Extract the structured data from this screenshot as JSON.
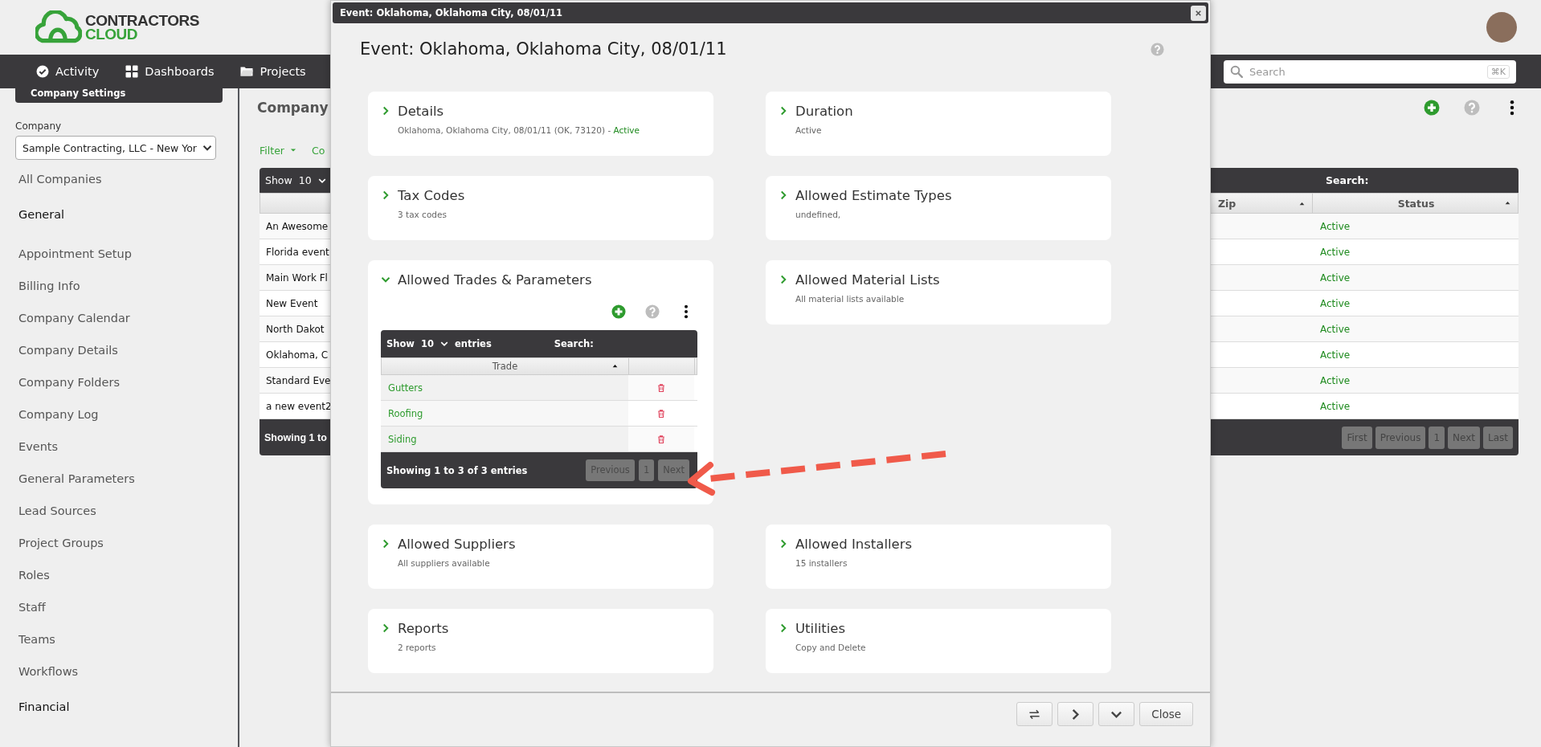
{
  "logo": {
    "line_1": "CONTRACTORS",
    "line_2": "CLOUD"
  },
  "nav": [
    {
      "label": "Activity"
    },
    {
      "label": "Dashboards"
    },
    {
      "label": "Projects"
    }
  ],
  "global_search": {
    "placeholder": "Search",
    "shortcut": "⌘K"
  },
  "sidebar": {
    "section_tab": "Company Settings",
    "company_label": "Company",
    "company_select": "Sample Contracting, LLC - New Yor",
    "items": [
      {
        "label": "All Companies",
        "kind": "link"
      },
      {
        "label": "General",
        "kind": "heading"
      },
      {
        "label": "Appointment Setup",
        "kind": "link"
      },
      {
        "label": "Billing Info",
        "kind": "link"
      },
      {
        "label": "Company Calendar",
        "kind": "link"
      },
      {
        "label": "Company Details",
        "kind": "link"
      },
      {
        "label": "Company Folders",
        "kind": "link"
      },
      {
        "label": "Company Log",
        "kind": "link"
      },
      {
        "label": "Events",
        "kind": "link"
      },
      {
        "label": "General Parameters",
        "kind": "link"
      },
      {
        "label": "Lead Sources",
        "kind": "link"
      },
      {
        "label": "Project Groups",
        "kind": "link"
      },
      {
        "label": "Roles",
        "kind": "link"
      },
      {
        "label": "Staff",
        "kind": "link"
      },
      {
        "label": "Teams",
        "kind": "link"
      },
      {
        "label": "Workflows",
        "kind": "link"
      },
      {
        "label": "Financial",
        "kind": "heading"
      }
    ]
  },
  "background": {
    "heading": "Company",
    "toolbar": [
      {
        "label": "Filter",
        "dropdown": true
      },
      {
        "label": "Co",
        "dropdown": false
      }
    ],
    "table": {
      "show": "Show",
      "show_value": "10",
      "search_label": "Search:",
      "columns": [
        "Zip",
        "Status"
      ],
      "rows": [
        {
          "column_1": "An Awesome",
          "status": "Active"
        },
        {
          "column_1": "Florida event",
          "status": "Active"
        },
        {
          "column_1": "Main Work Fl",
          "status": "Active"
        },
        {
          "column_1": "New Event",
          "status": "Active"
        },
        {
          "column_1": "North Dakot",
          "status": "Active"
        },
        {
          "column_1": "Oklahoma, C",
          "status": "Active"
        },
        {
          "column_1": "Standard Eve",
          "status": "Active"
        },
        {
          "column_1": "a new event2",
          "status": "Active"
        }
      ],
      "footer": "Showing 1 to",
      "pages": [
        "First",
        "Previous",
        "1",
        "Next",
        "Last"
      ]
    }
  },
  "modal": {
    "title_bar": "Event: Oklahoma, Oklahoma City, 08/01/11",
    "heading": "Event: Oklahoma, Oklahoma City, 08/01/11",
    "cards": [
      {
        "title": "Details",
        "subtitle": "Oklahoma, Oklahoma City, 08/01/11 (OK, 73120) -",
        "status": "Active",
        "expanded": false
      },
      {
        "title": "Duration",
        "subtitle": "Active",
        "expanded": false
      },
      {
        "title": "Tax Codes",
        "subtitle": "3 tax codes",
        "expanded": false
      },
      {
        "title": "Allowed Estimate Types",
        "subtitle": "undefined,",
        "expanded": false
      },
      {
        "title": "Allowed Trades & Parameters",
        "expanded": true,
        "table": {
          "show": "Show",
          "show_value": "10",
          "entries": "entries",
          "search_label": "Search:",
          "column": "Trade",
          "rows": [
            {
              "name": "Gutters"
            },
            {
              "name": "Roofing"
            },
            {
              "name": "Siding"
            }
          ],
          "footer": "Showing 1 to 3 of 3 entries",
          "pages": [
            "Previous",
            "1",
            "Next"
          ]
        }
      },
      {
        "title": "Allowed Material Lists",
        "subtitle": "All material lists available",
        "expanded": false
      },
      {
        "title": "Allowed Suppliers",
        "subtitle": "All suppliers available",
        "expanded": false
      },
      {
        "title": "Allowed Installers",
        "subtitle": "15 installers",
        "expanded": false
      },
      {
        "title": "Reports",
        "subtitle": "2 reports",
        "expanded": false
      },
      {
        "title": "Utilities",
        "subtitle": "Copy and Delete",
        "expanded": false
      }
    ],
    "footer_buttons": [
      {
        "kind": "icon"
      },
      {
        "kind": "icon"
      },
      {
        "kind": "icon"
      },
      {
        "kind": "text",
        "label": "Close"
      }
    ]
  }
}
